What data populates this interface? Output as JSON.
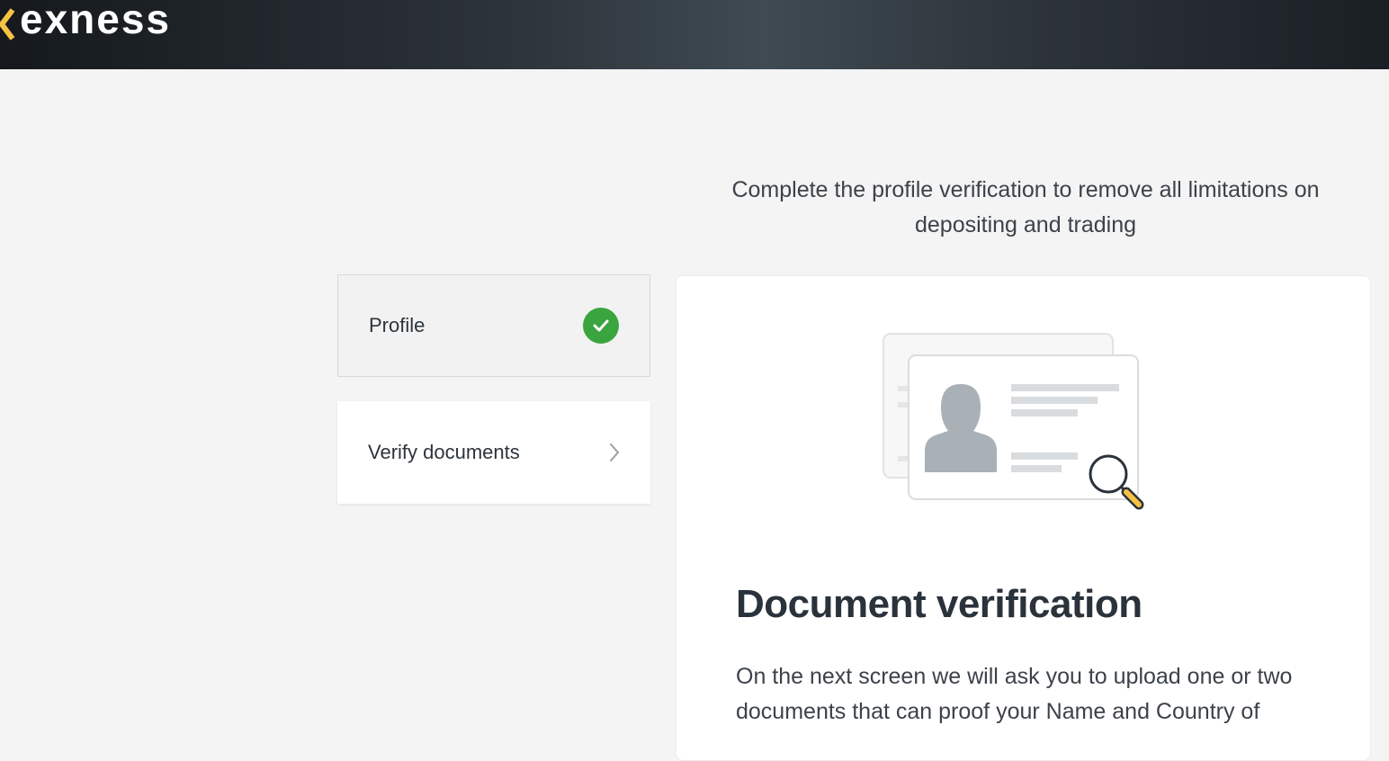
{
  "brand": {
    "name": "exness",
    "accent": "#f6c243"
  },
  "subtitle": "Complete the profile verification to remove all limitations on depositing and trading",
  "steps": [
    {
      "label": "Profile",
      "status": "completed",
      "icon": "check-circle-icon"
    },
    {
      "label": "Verify documents",
      "status": "current",
      "icon": "chevron-right-icon"
    }
  ],
  "card": {
    "illustration": "id-document-with-magnifier",
    "title": "Document verification",
    "body": "On the next screen we will ask you to upload one or two documents that can proof your Name and Country of"
  },
  "colors": {
    "success": "#3aa53f",
    "header_bg": "#2b3238",
    "page_bg": "#f4f4f4"
  }
}
